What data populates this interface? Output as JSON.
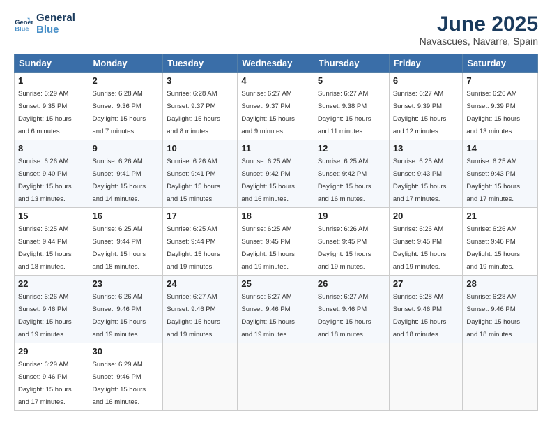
{
  "logo": {
    "line1": "General",
    "line2": "Blue"
  },
  "title": "June 2025",
  "subtitle": "Navascues, Navarre, Spain",
  "header_days": [
    "Sunday",
    "Monday",
    "Tuesday",
    "Wednesday",
    "Thursday",
    "Friday",
    "Saturday"
  ],
  "weeks": [
    [
      {
        "day": "1",
        "sunrise": "6:29 AM",
        "sunset": "9:35 PM",
        "daylight": "15 hours and 6 minutes."
      },
      {
        "day": "2",
        "sunrise": "6:28 AM",
        "sunset": "9:36 PM",
        "daylight": "15 hours and 7 minutes."
      },
      {
        "day": "3",
        "sunrise": "6:28 AM",
        "sunset": "9:37 PM",
        "daylight": "15 hours and 8 minutes."
      },
      {
        "day": "4",
        "sunrise": "6:27 AM",
        "sunset": "9:37 PM",
        "daylight": "15 hours and 9 minutes."
      },
      {
        "day": "5",
        "sunrise": "6:27 AM",
        "sunset": "9:38 PM",
        "daylight": "15 hours and 11 minutes."
      },
      {
        "day": "6",
        "sunrise": "6:27 AM",
        "sunset": "9:39 PM",
        "daylight": "15 hours and 12 minutes."
      },
      {
        "day": "7",
        "sunrise": "6:26 AM",
        "sunset": "9:39 PM",
        "daylight": "15 hours and 13 minutes."
      }
    ],
    [
      {
        "day": "8",
        "sunrise": "6:26 AM",
        "sunset": "9:40 PM",
        "daylight": "15 hours and 13 minutes."
      },
      {
        "day": "9",
        "sunrise": "6:26 AM",
        "sunset": "9:41 PM",
        "daylight": "15 hours and 14 minutes."
      },
      {
        "day": "10",
        "sunrise": "6:26 AM",
        "sunset": "9:41 PM",
        "daylight": "15 hours and 15 minutes."
      },
      {
        "day": "11",
        "sunrise": "6:25 AM",
        "sunset": "9:42 PM",
        "daylight": "15 hours and 16 minutes."
      },
      {
        "day": "12",
        "sunrise": "6:25 AM",
        "sunset": "9:42 PM",
        "daylight": "15 hours and 16 minutes."
      },
      {
        "day": "13",
        "sunrise": "6:25 AM",
        "sunset": "9:43 PM",
        "daylight": "15 hours and 17 minutes."
      },
      {
        "day": "14",
        "sunrise": "6:25 AM",
        "sunset": "9:43 PM",
        "daylight": "15 hours and 17 minutes."
      }
    ],
    [
      {
        "day": "15",
        "sunrise": "6:25 AM",
        "sunset": "9:44 PM",
        "daylight": "15 hours and 18 minutes."
      },
      {
        "day": "16",
        "sunrise": "6:25 AM",
        "sunset": "9:44 PM",
        "daylight": "15 hours and 18 minutes."
      },
      {
        "day": "17",
        "sunrise": "6:25 AM",
        "sunset": "9:44 PM",
        "daylight": "15 hours and 19 minutes."
      },
      {
        "day": "18",
        "sunrise": "6:25 AM",
        "sunset": "9:45 PM",
        "daylight": "15 hours and 19 minutes."
      },
      {
        "day": "19",
        "sunrise": "6:26 AM",
        "sunset": "9:45 PM",
        "daylight": "15 hours and 19 minutes."
      },
      {
        "day": "20",
        "sunrise": "6:26 AM",
        "sunset": "9:45 PM",
        "daylight": "15 hours and 19 minutes."
      },
      {
        "day": "21",
        "sunrise": "6:26 AM",
        "sunset": "9:46 PM",
        "daylight": "15 hours and 19 minutes."
      }
    ],
    [
      {
        "day": "22",
        "sunrise": "6:26 AM",
        "sunset": "9:46 PM",
        "daylight": "15 hours and 19 minutes."
      },
      {
        "day": "23",
        "sunrise": "6:26 AM",
        "sunset": "9:46 PM",
        "daylight": "15 hours and 19 minutes."
      },
      {
        "day": "24",
        "sunrise": "6:27 AM",
        "sunset": "9:46 PM",
        "daylight": "15 hours and 19 minutes."
      },
      {
        "day": "25",
        "sunrise": "6:27 AM",
        "sunset": "9:46 PM",
        "daylight": "15 hours and 19 minutes."
      },
      {
        "day": "26",
        "sunrise": "6:27 AM",
        "sunset": "9:46 PM",
        "daylight": "15 hours and 18 minutes."
      },
      {
        "day": "27",
        "sunrise": "6:28 AM",
        "sunset": "9:46 PM",
        "daylight": "15 hours and 18 minutes."
      },
      {
        "day": "28",
        "sunrise": "6:28 AM",
        "sunset": "9:46 PM",
        "daylight": "15 hours and 18 minutes."
      }
    ],
    [
      {
        "day": "29",
        "sunrise": "6:29 AM",
        "sunset": "9:46 PM",
        "daylight": "15 hours and 17 minutes."
      },
      {
        "day": "30",
        "sunrise": "6:29 AM",
        "sunset": "9:46 PM",
        "daylight": "15 hours and 16 minutes."
      },
      null,
      null,
      null,
      null,
      null
    ]
  ],
  "labels": {
    "sunrise": "Sunrise:",
    "sunset": "Sunset:",
    "daylight": "Daylight:"
  }
}
